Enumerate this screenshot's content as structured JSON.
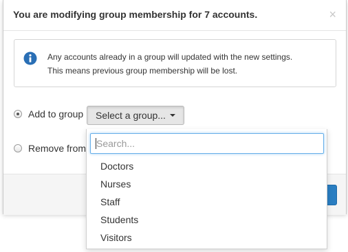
{
  "modal": {
    "title": "You are modifying group membership for 7 accounts.",
    "close_label": "×"
  },
  "info": {
    "icon": "info-circle-icon",
    "line1": "Any accounts already in a group will updated with the new settings.",
    "line2": "This means previous group membership will be lost."
  },
  "options": {
    "add_label": "Add to group",
    "add_checked": true,
    "remove_label": "Remove from",
    "remove_checked": false
  },
  "select": {
    "label": "Select a group...",
    "search_placeholder": "Search...",
    "items": [
      "Doctors",
      "Nurses",
      "Staff",
      "Students",
      "Visitors"
    ]
  },
  "colors": {
    "primary": "#2a7ec2",
    "info_icon": "#2a6fb5",
    "focus": "#66afe9"
  }
}
